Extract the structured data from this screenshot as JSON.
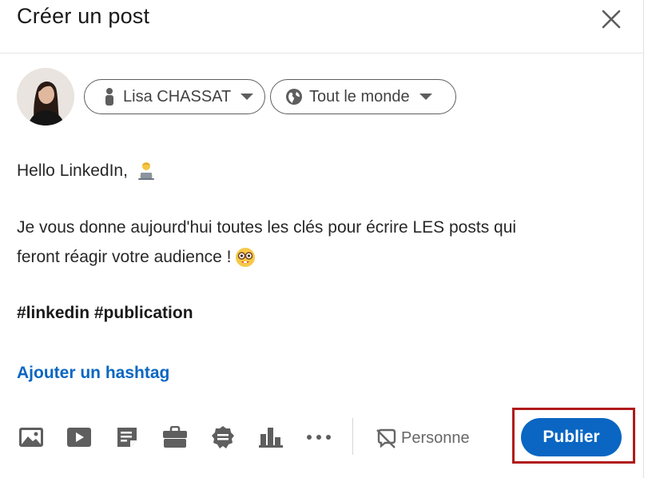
{
  "header": {
    "title": "Créer un post"
  },
  "author": {
    "name": "Lisa CHASSAT"
  },
  "visibility": {
    "label": "Tout le monde"
  },
  "post": {
    "line1": "Hello LinkedIn,",
    "line2": "Je vous donne aujourd'hui toutes les clés pour écrire LES posts qui",
    "line3": "feront réagir votre audience !",
    "line4": "#linkedin #publication"
  },
  "add_hashtag": "Ajouter un hashtag",
  "toolbar": {
    "icons": [
      "image-icon",
      "video-icon",
      "document-icon",
      "job-icon",
      "celebrate-icon",
      "poll-icon",
      "more-icon"
    ]
  },
  "comment_control": {
    "label": "Personne"
  },
  "publish": {
    "label": "Publier"
  },
  "colors": {
    "accent": "#0a66c2",
    "highlight": "#b01a1a"
  }
}
